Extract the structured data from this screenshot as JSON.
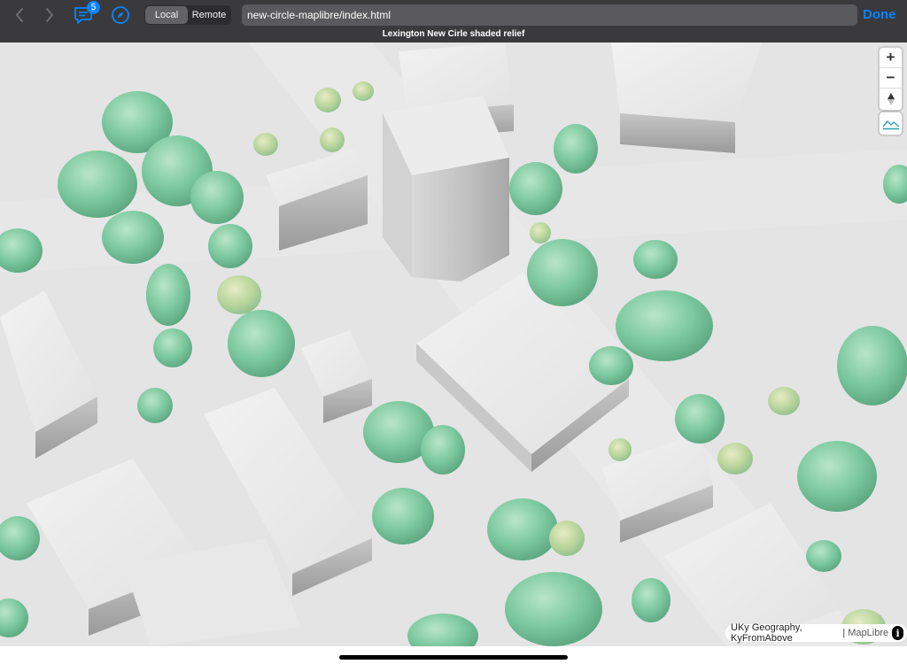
{
  "toolbar": {
    "badge_count": "5",
    "segments": [
      {
        "label": "Local",
        "active": true
      },
      {
        "label": "Remote",
        "active": false
      }
    ],
    "url": "new-circle-maplibre/index.html",
    "done_label": "Done"
  },
  "page": {
    "title": "Lexington New Cirle shaded relief"
  },
  "map": {
    "zoom_in_label": "+",
    "zoom_out_label": "−",
    "attribution": {
      "sources": "UKy Geography, KyFromAbove",
      "separator": "|",
      "library": "MapLibre",
      "info_label": "i"
    }
  },
  "colors": {
    "toolbar_bg": "#3a3a3c",
    "accent": "#0a84ff",
    "terrain": "#dcdcdc",
    "vegetation": "#7dc9a0"
  },
  "icons": [
    "chevron-left-icon",
    "chevron-right-icon",
    "comments-icon",
    "compass-icon",
    "north-arrow-icon",
    "terrain-icon",
    "info-icon"
  ]
}
